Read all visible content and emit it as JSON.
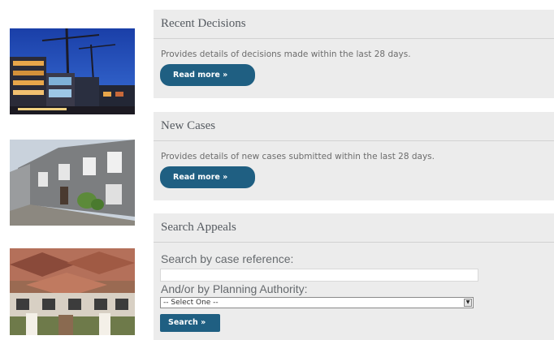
{
  "decisions": {
    "title": "Recent Decisions",
    "description": "Provides details of decisions made within the last 28 days.",
    "read_more_label": "Read more »"
  },
  "cases": {
    "title": "New Cases",
    "description": "Provides details of new cases submitted within the last 28 days.",
    "read_more_label": "Read more »"
  },
  "search": {
    "title": "Search Appeals",
    "case_reference_label": "Search by case reference:",
    "case_reference_value": "",
    "authority_label": "And/or by Planning Authority:",
    "authority_selected": "-- Select One --",
    "button_label": "Search »"
  },
  "colors": {
    "panel_background": "#ececec",
    "button_blue": "#1f5f82"
  }
}
